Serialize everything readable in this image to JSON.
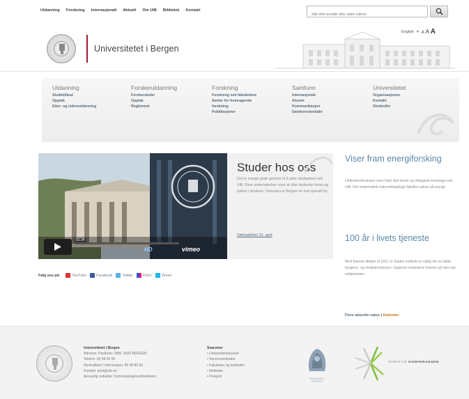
{
  "top_nav": {
    "items": [
      "Utdanning",
      "Forskning",
      "Internasjonalt",
      "Aktuelt",
      "Om UiB",
      "Bibliotek",
      "Kontakt"
    ],
    "search_placeholder": "Søk etter ansatte eller saker sidene"
  },
  "header": {
    "title": "Universitetet i Bergen",
    "lang": "English",
    "font_size_small": "A",
    "font_size_medium": "A",
    "font_size_large": "A"
  },
  "megamenu": {
    "columns": [
      {
        "heading": "Utdanning",
        "items": [
          "Studietilbud",
          "Opptak",
          "Etter- og videreutdanning"
        ]
      },
      {
        "heading": "Forskerutdanning",
        "items": [
          "Forskerskoler",
          "Opptak",
          "Reglement"
        ]
      },
      {
        "heading": "Forskning",
        "items": [
          "Forskning ved fakultetene",
          "Senter for fremragende forskning",
          "Publikasjoner"
        ]
      },
      {
        "heading": "Samfunn",
        "items": [
          "Internasjonalt",
          "Alumni",
          "Kommunikasjon",
          "Samfunnskontakt"
        ]
      },
      {
        "heading": "Universitetet",
        "items": [
          "Organisasjonen",
          "Kontakt",
          "Studentliv"
        ]
      }
    ]
  },
  "feature": {
    "title": "Studer hos oss",
    "text": "Det er mange gode grunner til å søke studieplass ved UiB. Flere undersøkelser viser at våre studenter trives og lykkes i studiene. Dessuten er Bergen en helt spesiell by.",
    "link": "Søknadsfrist 15. april",
    "video_time": "01:24",
    "video_hd": "HD",
    "video_brand": "vimeo"
  },
  "follow": {
    "label": "Følg oss på:",
    "items": [
      "YouTube",
      "Facebook",
      "Twitter",
      "Flickr",
      "Vimeo"
    ]
  },
  "news": {
    "items": [
      {
        "title": "Viser fram energiforsking",
        "text": "Ulriktekonferansen viser fram den beste og viktigaste forskinga ved UiB. Det matematisk-naturvitskaplege fakultet satsar på energi."
      },
      {
        "title": "100 år i livets tjeneste",
        "text": "Med historie tilbake til 1912 er Gades institutt en viktig del av både bergens- og medisinhistorien. Oppleve institutters historie på den nye nettportalen."
      }
    ],
    "more_link": "Flere aktuelle saker",
    "separator": "|",
    "calendar_link": "Kalender"
  },
  "footer": {
    "org": "Universitetet i Bergen",
    "lines": [
      "Adresse: Postboks 7800, 5020 BERGEN",
      "Telefon: 55 58 00 00",
      "Sentralbord / informasjon: 55 58 80 00",
      "Kontakt: post@uib.no",
      "Ansvarlig redaktør: Kommunikasjonsdirektøren"
    ],
    "shortcuts_title": "Snarveier",
    "shortcuts": [
      "Universitetsmuseet",
      "Servicesentralen",
      "Fakulteter og institutter",
      "Nettsider",
      "Prosjekt"
    ],
    "holberg_label": "HOLBERG PRISEN",
    "kavli_label": "CHRISTIE",
    "kavli_bold": "KONFERANSEN"
  },
  "colors": {
    "accent": "#a6192e",
    "link": "#5a87a8",
    "calendar": "#c67a17"
  }
}
